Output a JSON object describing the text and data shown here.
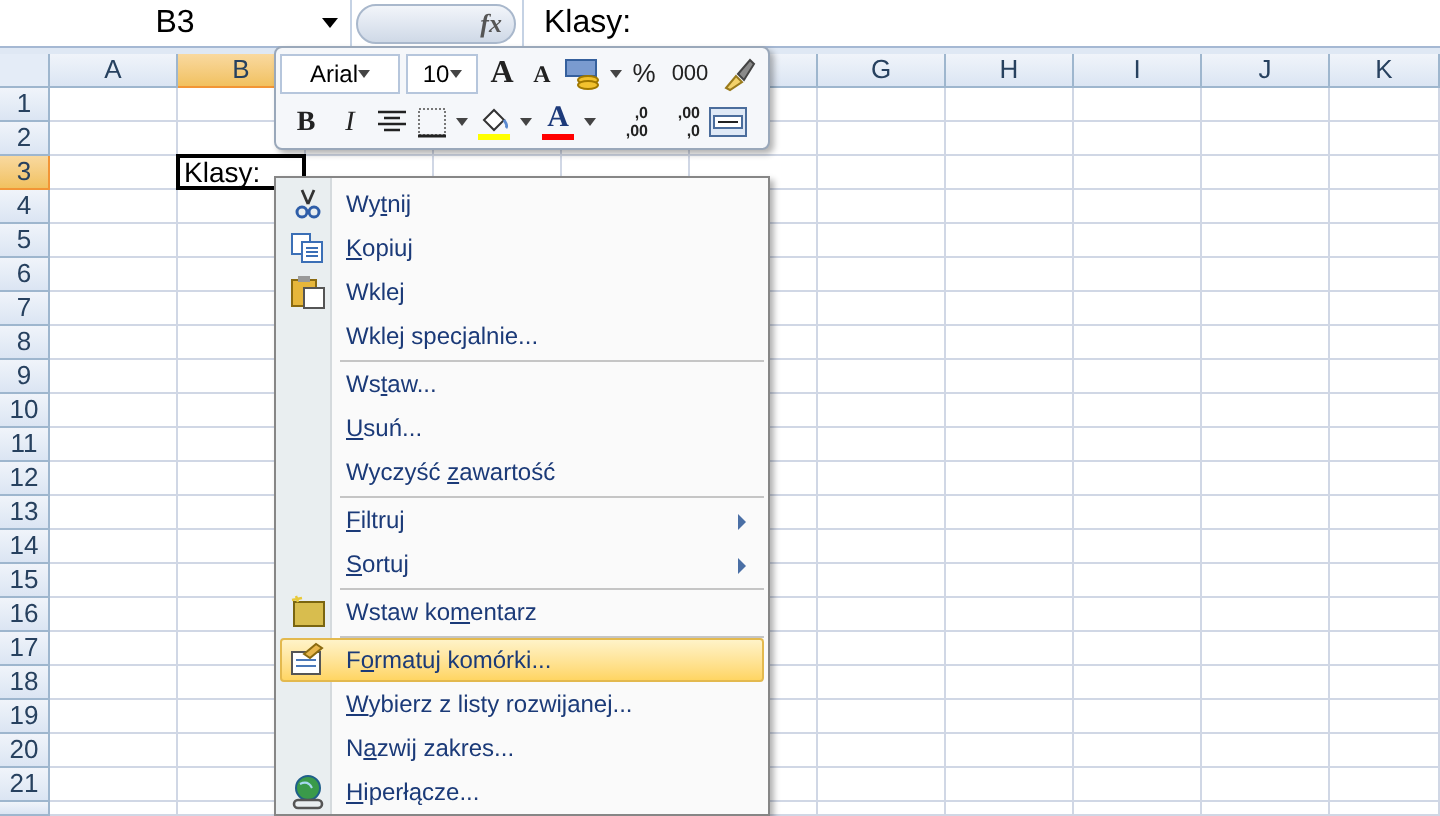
{
  "formula_bar": {
    "name_box": "B3",
    "fx": "fx",
    "value": "Klasy:"
  },
  "columns": [
    {
      "label": "A",
      "selected": false
    },
    {
      "label": "B",
      "selected": true
    },
    {
      "label": "G",
      "selected": false
    },
    {
      "label": "H",
      "selected": false
    },
    {
      "label": "I",
      "selected": false
    },
    {
      "label": "J",
      "selected": false
    },
    {
      "label": "K",
      "selected": false
    }
  ],
  "rows": [
    {
      "label": "1",
      "selected": false
    },
    {
      "label": "2",
      "selected": false
    },
    {
      "label": "3",
      "selected": true
    },
    {
      "label": "4",
      "selected": false
    },
    {
      "label": "5",
      "selected": false
    },
    {
      "label": "6",
      "selected": false
    },
    {
      "label": "7",
      "selected": false
    },
    {
      "label": "8",
      "selected": false
    },
    {
      "label": "9",
      "selected": false
    },
    {
      "label": "10",
      "selected": false
    },
    {
      "label": "11",
      "selected": false
    },
    {
      "label": "12",
      "selected": false
    },
    {
      "label": "13",
      "selected": false
    },
    {
      "label": "14",
      "selected": false
    },
    {
      "label": "15",
      "selected": false
    },
    {
      "label": "16",
      "selected": false
    },
    {
      "label": "17",
      "selected": false
    },
    {
      "label": "18",
      "selected": false
    },
    {
      "label": "19",
      "selected": false
    },
    {
      "label": "20",
      "selected": false
    },
    {
      "label": "21",
      "selected": false
    }
  ],
  "active_cell": {
    "text": "Klasy:"
  },
  "mini_toolbar": {
    "font": "Arial",
    "size": "10",
    "grow": "A",
    "shrink": "A",
    "percent": "%",
    "thousands": "000",
    "bold": "B",
    "italic": "I",
    "font_color": "A",
    "increase_decimal": {
      "top": ",0",
      "bottom": ",00"
    },
    "decrease_decimal": {
      "top": ",00",
      "bottom": ",0"
    }
  },
  "context_menu": [
    {
      "before": "Wy",
      "accel": "t",
      "after": "nij",
      "selected": false,
      "submenu": false,
      "separator_before": false
    },
    {
      "accel": "K",
      "after": "opiuj",
      "selected": false,
      "submenu": false,
      "separator_before": false
    },
    {
      "before": "Wkle",
      "accel": "j",
      "selected": false,
      "submenu": false,
      "separator_before": false
    },
    {
      "before": "Wkle",
      "accel": "j",
      "after": " specjalnie...",
      "selected": false,
      "submenu": false,
      "separator_before": false
    },
    {
      "before": "Ws",
      "accel": "t",
      "after": "aw...",
      "selected": false,
      "submenu": false,
      "separator_before": true
    },
    {
      "accel": "U",
      "after": "suń...",
      "selected": false,
      "submenu": false,
      "separator_before": false
    },
    {
      "before": "Wyczyść ",
      "accel": "z",
      "after": "awartość",
      "selected": false,
      "submenu": false,
      "separator_before": false
    },
    {
      "accel": "F",
      "after": "iltruj",
      "selected": false,
      "submenu": true,
      "separator_before": true
    },
    {
      "accel": "S",
      "after": "ortuj",
      "selected": false,
      "submenu": true,
      "separator_before": false
    },
    {
      "before": "Wstaw ko",
      "accel": "m",
      "after": "entarz",
      "selected": false,
      "submenu": false,
      "separator_before": true
    },
    {
      "before": "F",
      "accel": "o",
      "after": "rmatuj komórki...",
      "selected": true,
      "submenu": false,
      "separator_before": true
    },
    {
      "accel": "W",
      "after": "ybierz z listy rozwijanej...",
      "selected": false,
      "submenu": false,
      "separator_before": false
    },
    {
      "before": "N",
      "accel": "a",
      "after": "zwij zakres...",
      "selected": false,
      "submenu": false,
      "separator_before": false
    },
    {
      "accel": "H",
      "after": "iperłącze...",
      "selected": false,
      "submenu": false,
      "separator_before": false
    }
  ]
}
